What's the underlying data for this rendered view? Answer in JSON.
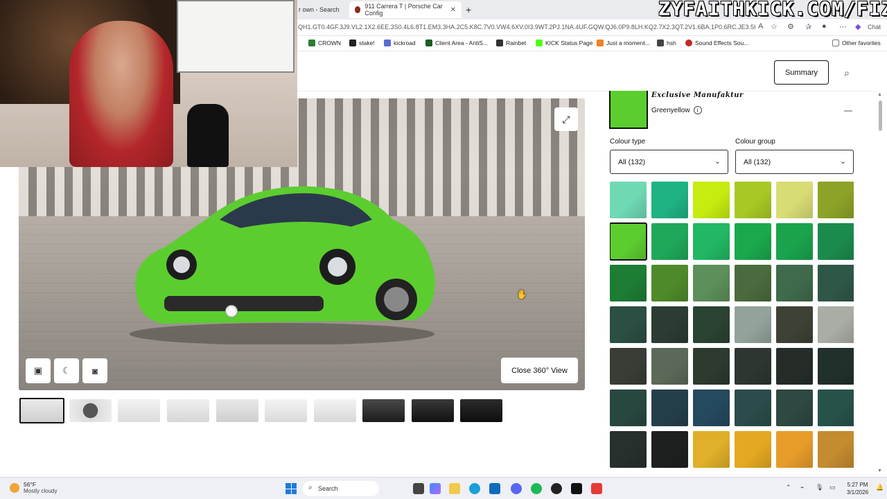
{
  "browser": {
    "tabs": [
      {
        "label": "r own - Search",
        "active": false
      },
      {
        "label": "911 Carrera T | Porsche Car Config",
        "active": true
      }
    ],
    "url": "QH1.GT0.4GF.3J9.VL2.1X2.6EE.3S0.4L6.8T1.EM3.3HA.2C5.K8C.7V0.VW4.6XV.0I3.9WT.2PJ.1NA.4UF.GQW.QJ6.0P9.8LH.KQ2.7X2.3QT.2V1.6BA.1P0.6RC.JE3.5KS.9JA...",
    "chat_label": "Chat",
    "bookmarks": [
      {
        "label": "CROWN",
        "color": "#2e7d32"
      },
      {
        "label": "stake!",
        "color": "#222"
      },
      {
        "label": "kickroad",
        "color": "#5b6bd1"
      },
      {
        "label": "Client Area - AntiS...",
        "color": "#1b5e20"
      },
      {
        "label": "Rainbet",
        "color": "#333"
      },
      {
        "label": "KICK Status Page",
        "color": "#53fc18"
      },
      {
        "label": "Just a moment...",
        "color": "#f48024"
      },
      {
        "label": "hsh",
        "color": "#444"
      },
      {
        "label": "Sound Effects Sou...",
        "color": "#c62828"
      }
    ],
    "other_favorites": "Other favorites"
  },
  "overlay": {
    "watermark": "ZYFAITHKICK.COM/FIZ"
  },
  "header": {
    "summary_label": "Summary"
  },
  "viewer": {
    "close_360_label": "Close 360° View",
    "thumbnail_count": 10
  },
  "panel": {
    "exclusive_label": "Exclusive Manufaktur",
    "color_name": "Greenyellow",
    "colour_type_label": "Colour type",
    "colour_type_value": "All (132)",
    "colour_group_label": "Colour group",
    "colour_group_value": "All (132)",
    "selected_color": "#5ccd2f",
    "swatches": [
      [
        "#6fd9b4",
        "#1fb384",
        "#c6ec10",
        "#a8c925",
        "#d8dc74",
        "#8da327"
      ],
      [
        "#5ccd2f",
        "#1fa85a",
        "#22b863",
        "#1aa84c",
        "#1aa34c",
        "#1b8b4c"
      ],
      [
        "#1d7d34",
        "#4f8a2a",
        "#5c8f59",
        "#4a6b3d",
        "#3f6a4c",
        "#2f5747"
      ],
      [
        "#2b4f43",
        "#2c3c32",
        "#2a4333",
        "#93a39b",
        "#3d4235",
        "#a9ada6"
      ],
      [
        "#3a3d35",
        "#5b6a58",
        "#2c3a30",
        "#2e3631",
        "#262d29",
        "#22302c"
      ],
      [
        "#294741",
        "#253f4a",
        "#25495e",
        "#2a4c4a",
        "#2e4842",
        "#27524a"
      ],
      [
        "#27302d",
        "#1d201f",
        "#e0b02a",
        "#e5a822",
        "#e79c2a",
        "#c48b2f"
      ]
    ],
    "selected_swatch_index": 6
  },
  "taskbar": {
    "temperature": "56°F",
    "condition": "Mostly cloudy",
    "weather_badge": "2",
    "search_label": "Search",
    "time": "5:27 PM",
    "date": "3/1/2026"
  }
}
